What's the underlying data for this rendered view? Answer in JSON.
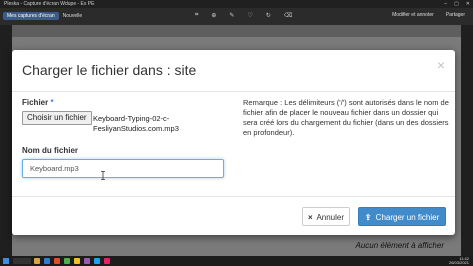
{
  "window": {
    "title": "Pleska - Capture d'écran Wdupe - Ex PE"
  },
  "toolbar": {
    "tab_label": "Mes captures d'écran",
    "secondary_label": "Nouvelle",
    "right_items": [
      "Modifier et annoter",
      "Partager"
    ]
  },
  "modal": {
    "title": "Charger le fichier dans : site",
    "close_symbol": "×",
    "file_label": "Fichier",
    "required_mark": "*",
    "choose_file_button": "Choisir un fichier",
    "file_name": "Keyboard-Typing-02-c-FesliyanStudios.com.mp3",
    "name_label": "Nom du fichier",
    "name_value": "Keyboard.mp3",
    "remark": "Remarque : Les délimiteurs ('/') sont autorisés dans le nom de fichier afin de placer le nouveau fichier dans un dossier qui sera créé lors du chargement du fichier (dans un des dossiers en profondeur).",
    "cancel_button": "Annuler",
    "cancel_icon": "×",
    "upload_button": "Charger un fichier",
    "upload_icon": "⇪"
  },
  "background": {
    "empty_message": "Aucun élément à afficher"
  },
  "taskbar": {
    "time": "11:42",
    "date": "26/03/2021"
  },
  "colors": {
    "primary": "#428bca",
    "focus": "#66afe9"
  }
}
